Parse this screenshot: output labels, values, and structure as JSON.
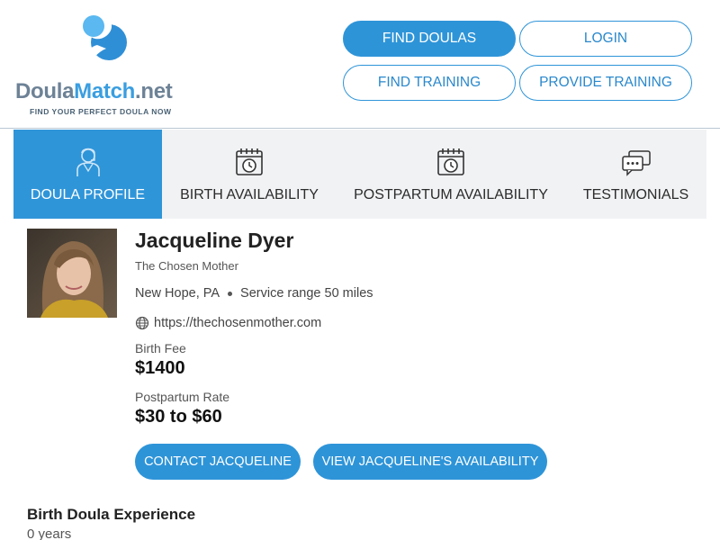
{
  "site": {
    "logo": {
      "part1": "Doula",
      "part2": "Match",
      "part3": ".net",
      "tagline": "FIND YOUR PERFECT DOULA NOW"
    },
    "colors": {
      "brand_blue": "#2e94d8",
      "logo_gray": "#6d8296",
      "tab_background": "#f1f2f4"
    }
  },
  "nav": {
    "find_doulas": "FIND DOULAS",
    "login": "LOGIN",
    "find_training": "FIND TRAINING",
    "provide_training": "PROVIDE TRAINING"
  },
  "tabs": [
    {
      "label": "DOULA PROFILE",
      "icon": "doula-person-icon",
      "active": true
    },
    {
      "label": "BIRTH AVAILABILITY",
      "icon": "calendar-clock-icon",
      "active": false
    },
    {
      "label": "POSTPARTUM AVAILABILITY",
      "icon": "calendar-clock-icon",
      "active": false
    },
    {
      "label": "TESTIMONIALS",
      "icon": "chat-bubbles-icon",
      "active": false
    }
  ],
  "profile": {
    "name": "Jacqueline Dyer",
    "business": "The Chosen Mother",
    "location": "New Hope, PA",
    "service_range": "Service range 50 miles",
    "website": "https://thechosenmother.com",
    "birth_fee_label": "Birth Fee",
    "birth_fee": "$1400",
    "postpartum_rate_label": "Postpartum Rate",
    "postpartum_rate": "$30 to $60",
    "contact_button": "CONTACT JACQUELINE",
    "availability_button": "VIEW JACQUELINE'S AVAILABILITY"
  },
  "experience": {
    "title": "Birth Doula Experience",
    "value": "0 years"
  }
}
